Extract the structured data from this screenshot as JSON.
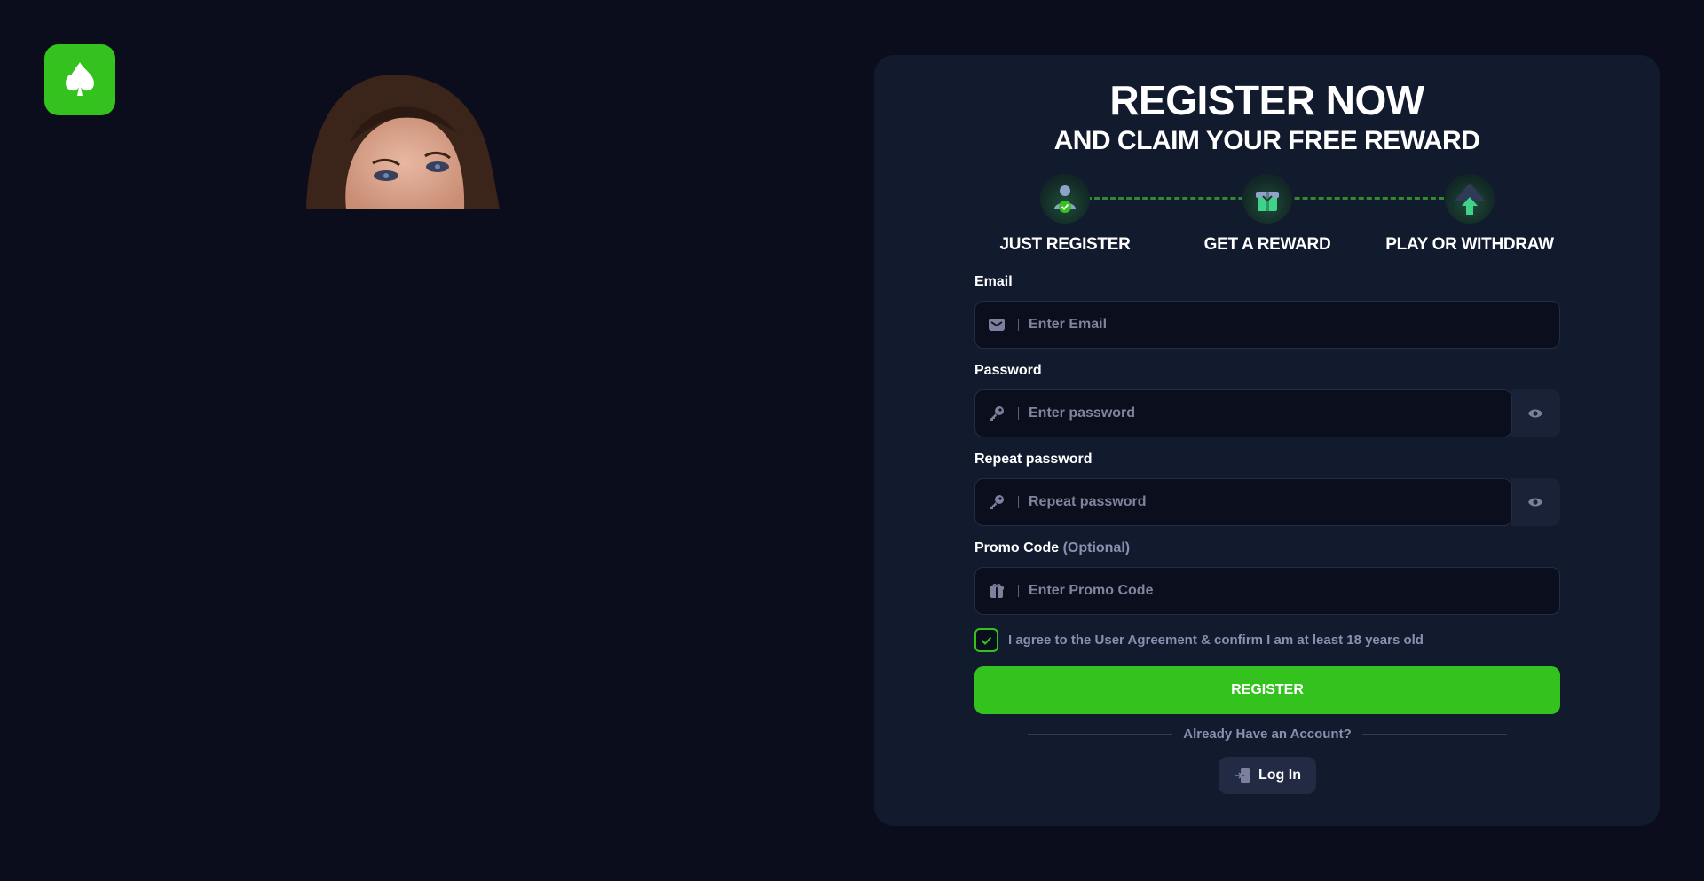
{
  "header": {
    "logo_icon": "spade-icon",
    "brand_color": "#34c21f"
  },
  "hero": {
    "image": "woman-portrait"
  },
  "register": {
    "title": "REGISTER NOW",
    "subtitle": "AND CLAIM YOUR FREE REWARD",
    "steps": [
      {
        "label": "JUST REGISTER",
        "icon": "user-check-icon"
      },
      {
        "label": "GET A REWARD",
        "icon": "gift-icon"
      },
      {
        "label": "PLAY OR WITHDRAW",
        "icon": "arrow-up-icon"
      }
    ],
    "email": {
      "label": "Email",
      "placeholder": "Enter Email",
      "value": "",
      "icon": "envelope-icon"
    },
    "password": {
      "label": "Password",
      "placeholder": "Enter password",
      "value": "",
      "icon": "key-icon"
    },
    "repeat_password": {
      "label": "Repeat password",
      "placeholder": "Repeat password",
      "value": "",
      "icon": "key-icon"
    },
    "promo": {
      "label": "Promo Code",
      "optional": "(Optional)",
      "placeholder": "Enter Promo Code",
      "value": "",
      "icon": "gift-icon"
    },
    "agreement": {
      "text": "I agree to the User Agreement & confirm I am at least 18 years old",
      "checked": true
    },
    "register_label": "REGISTER",
    "already_text": "Already Have an Account?",
    "login_label": "Log In"
  }
}
